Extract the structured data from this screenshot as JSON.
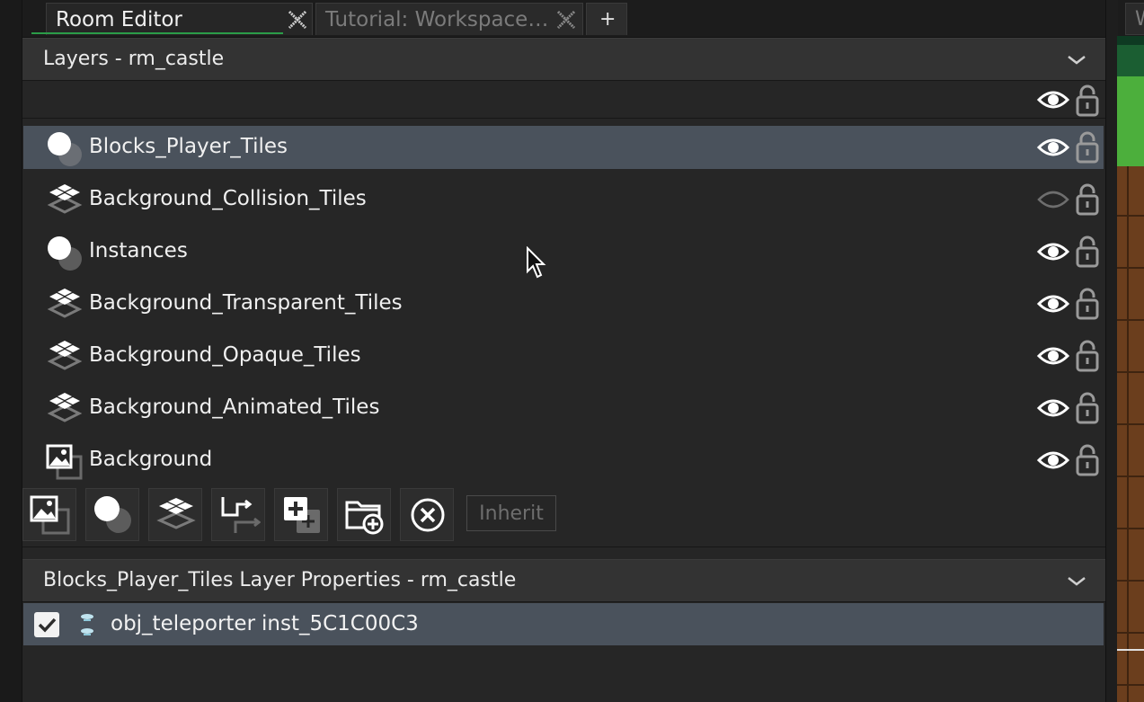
{
  "tabs": [
    {
      "label": "Room Editor",
      "active": true
    },
    {
      "label": "Tutorial: Workspace…",
      "active": false
    }
  ],
  "add_tab_label": "+",
  "right_tab_label": "W",
  "layers_header": {
    "title": "Layers - rm_castle"
  },
  "layers": [
    {
      "name": "Blocks_Player_Tiles",
      "type": "instance",
      "visible": true,
      "locked": false,
      "selected": true
    },
    {
      "name": "Background_Collision_Tiles",
      "type": "tile",
      "visible": false,
      "locked": false,
      "selected": false
    },
    {
      "name": "Instances",
      "type": "instance",
      "visible": true,
      "locked": false,
      "selected": false
    },
    {
      "name": "Background_Transparent_Tiles",
      "type": "tile",
      "visible": true,
      "locked": false,
      "selected": false
    },
    {
      "name": "Background_Opaque_Tiles",
      "type": "tile",
      "visible": true,
      "locked": false,
      "selected": false
    },
    {
      "name": "Background_Animated_Tiles",
      "type": "tile",
      "visible": true,
      "locked": false,
      "selected": false
    },
    {
      "name": "Background",
      "type": "background",
      "visible": true,
      "locked": false,
      "selected": false
    }
  ],
  "toolbar": {
    "buttons": [
      "add-background-layer",
      "add-instance-layer",
      "add-tile-layer",
      "add-path-layer",
      "add-asset-layer",
      "add-folder",
      "delete-layer"
    ],
    "inherit_label": "Inherit"
  },
  "properties_header": {
    "title": "Blocks_Player_Tiles Layer Properties - rm_castle"
  },
  "instances": [
    {
      "checked": true,
      "object": "obj_teleporter",
      "id": "inst_5C1C00C3"
    }
  ],
  "colors": {
    "selected_row": "#4a525c",
    "tab_accent": "#2b9c48",
    "panel_bg": "#262626",
    "header_bg": "#333333"
  }
}
